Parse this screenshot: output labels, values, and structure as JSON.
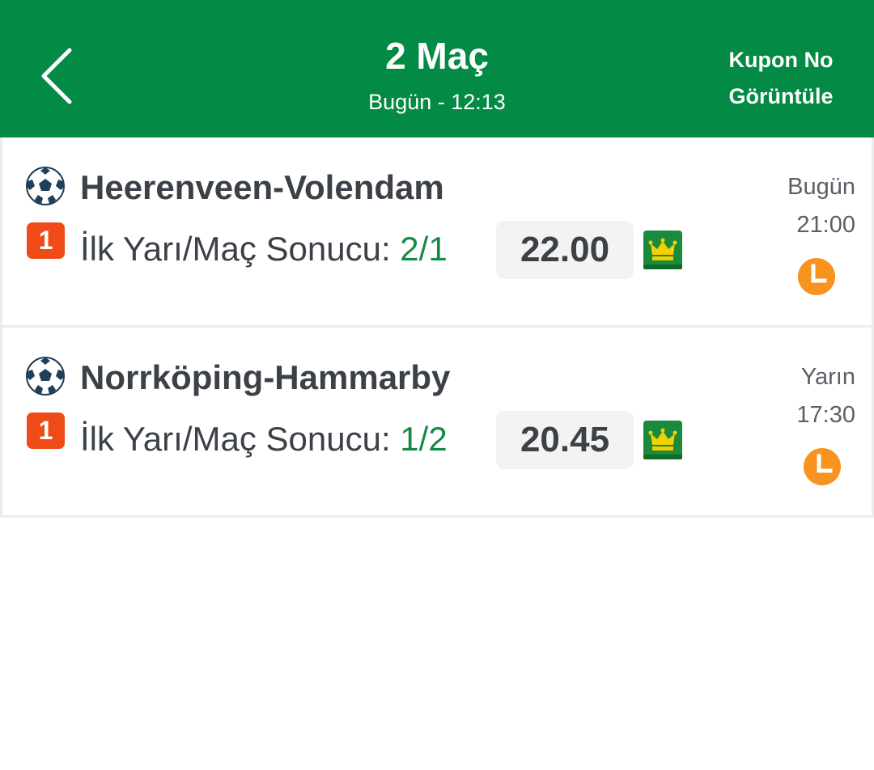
{
  "header": {
    "title": "2 Maç",
    "subtitle": "Bugün - 12:13",
    "kupon_line1": "Kupon No",
    "kupon_line2": "Görüntüle",
    "bg_color": "#038a44"
  },
  "matches": [
    {
      "name": "Heerenveen-Volendam",
      "pick_number": "1",
      "market_label": "İlk Yarı/Maç Sonucu:",
      "market_pick": "2/1",
      "odds": "22.00",
      "day": "Bugün",
      "time": "21:00",
      "icons": [
        "soccer-ball-icon",
        "crown-icon",
        "clock-icon"
      ]
    },
    {
      "name": "Norrköping-Hammarby",
      "pick_number": "1",
      "market_label": "İlk Yarı/Maç Sonucu:",
      "market_pick": "1/2",
      "odds": "20.45",
      "day": "Yarın",
      "time": "17:30",
      "icons": [
        "soccer-ball-icon",
        "crown-icon",
        "clock-icon"
      ]
    }
  ],
  "colors": {
    "accent_green": "#168a45",
    "badge_orange": "#ee4b17",
    "clock_orange": "#f7931e",
    "crown_bg": "#1a8a3c",
    "crown_gold": "#f5d000"
  }
}
